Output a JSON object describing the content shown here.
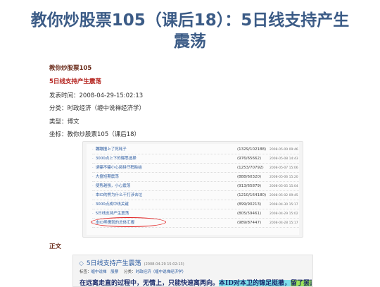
{
  "title": "教你炒股票105（课后18）：5日线支持产生震荡",
  "series_label": "教你炒股票105",
  "sub_title": "5日线支持产生震荡",
  "publish": "发表时间：2008-04-29-15:02:13",
  "category": "分类：时政经济（缠中说禅经济学）",
  "type": "类型：博文",
  "coord": "坐标：教你炒股票105（课后18）",
  "list": [
    {
      "label": "蹦蹦撞上了死耗子",
      "count": "(1329/102188)",
      "date": "2008-05-09 09:46"
    },
    {
      "label": "3000点上下的爆悉选择",
      "count": "(976/65662)",
      "date": "2008-05-08 14:43"
    },
    {
      "label": "诱骗不骗小心阅拼仔稍赊结",
      "count": "(1253/70792)",
      "date": "2008-05-07 15:06"
    },
    {
      "label": "大盘短期震荡",
      "count": "(888/60320)",
      "date": "2008-05-06 15:20"
    },
    {
      "label": "使势越强，小心震荡",
      "count": "(913/65879)",
      "date": "2008-05-05 15:04"
    },
    {
      "label": "本ID的熊为什么干打涉去垃",
      "count": "(1210/164180)",
      "date": "2008-05-02 09:45"
    },
    {
      "label": "3000点成中线关键",
      "count": "(899/90213)",
      "date": "2008-04-30 15:17"
    },
    {
      "label": "5日线支持产生震荡",
      "count": "(805/59461)",
      "date": "2008-04-29 15:02"
    },
    {
      "label": "本ID熊儒就的总体汇报",
      "count": "(989/87447)",
      "date": "2008-04-28 15:17"
    }
  ],
  "section_label": "正文",
  "article": {
    "title": "5日线支持产生震荡",
    "date": "(2008-04-29 15:02:13)",
    "tag_prefix": "标签：",
    "tag": "缠中说禅",
    "stock_label": "股票",
    "category_prefix": "分类：",
    "category_link": "时政经济（缠中说禅经济学）",
    "body_plain": "在远离走直的过程中，无情上，只能快速离两向。",
    "body_hl1": "本ID对本卫的锦足挺撤，",
    "body_hl2": "留了罢正向"
  },
  "colors": {
    "title": "#3b5b86",
    "link": "#2a5aa0",
    "circle": "#e12424"
  }
}
